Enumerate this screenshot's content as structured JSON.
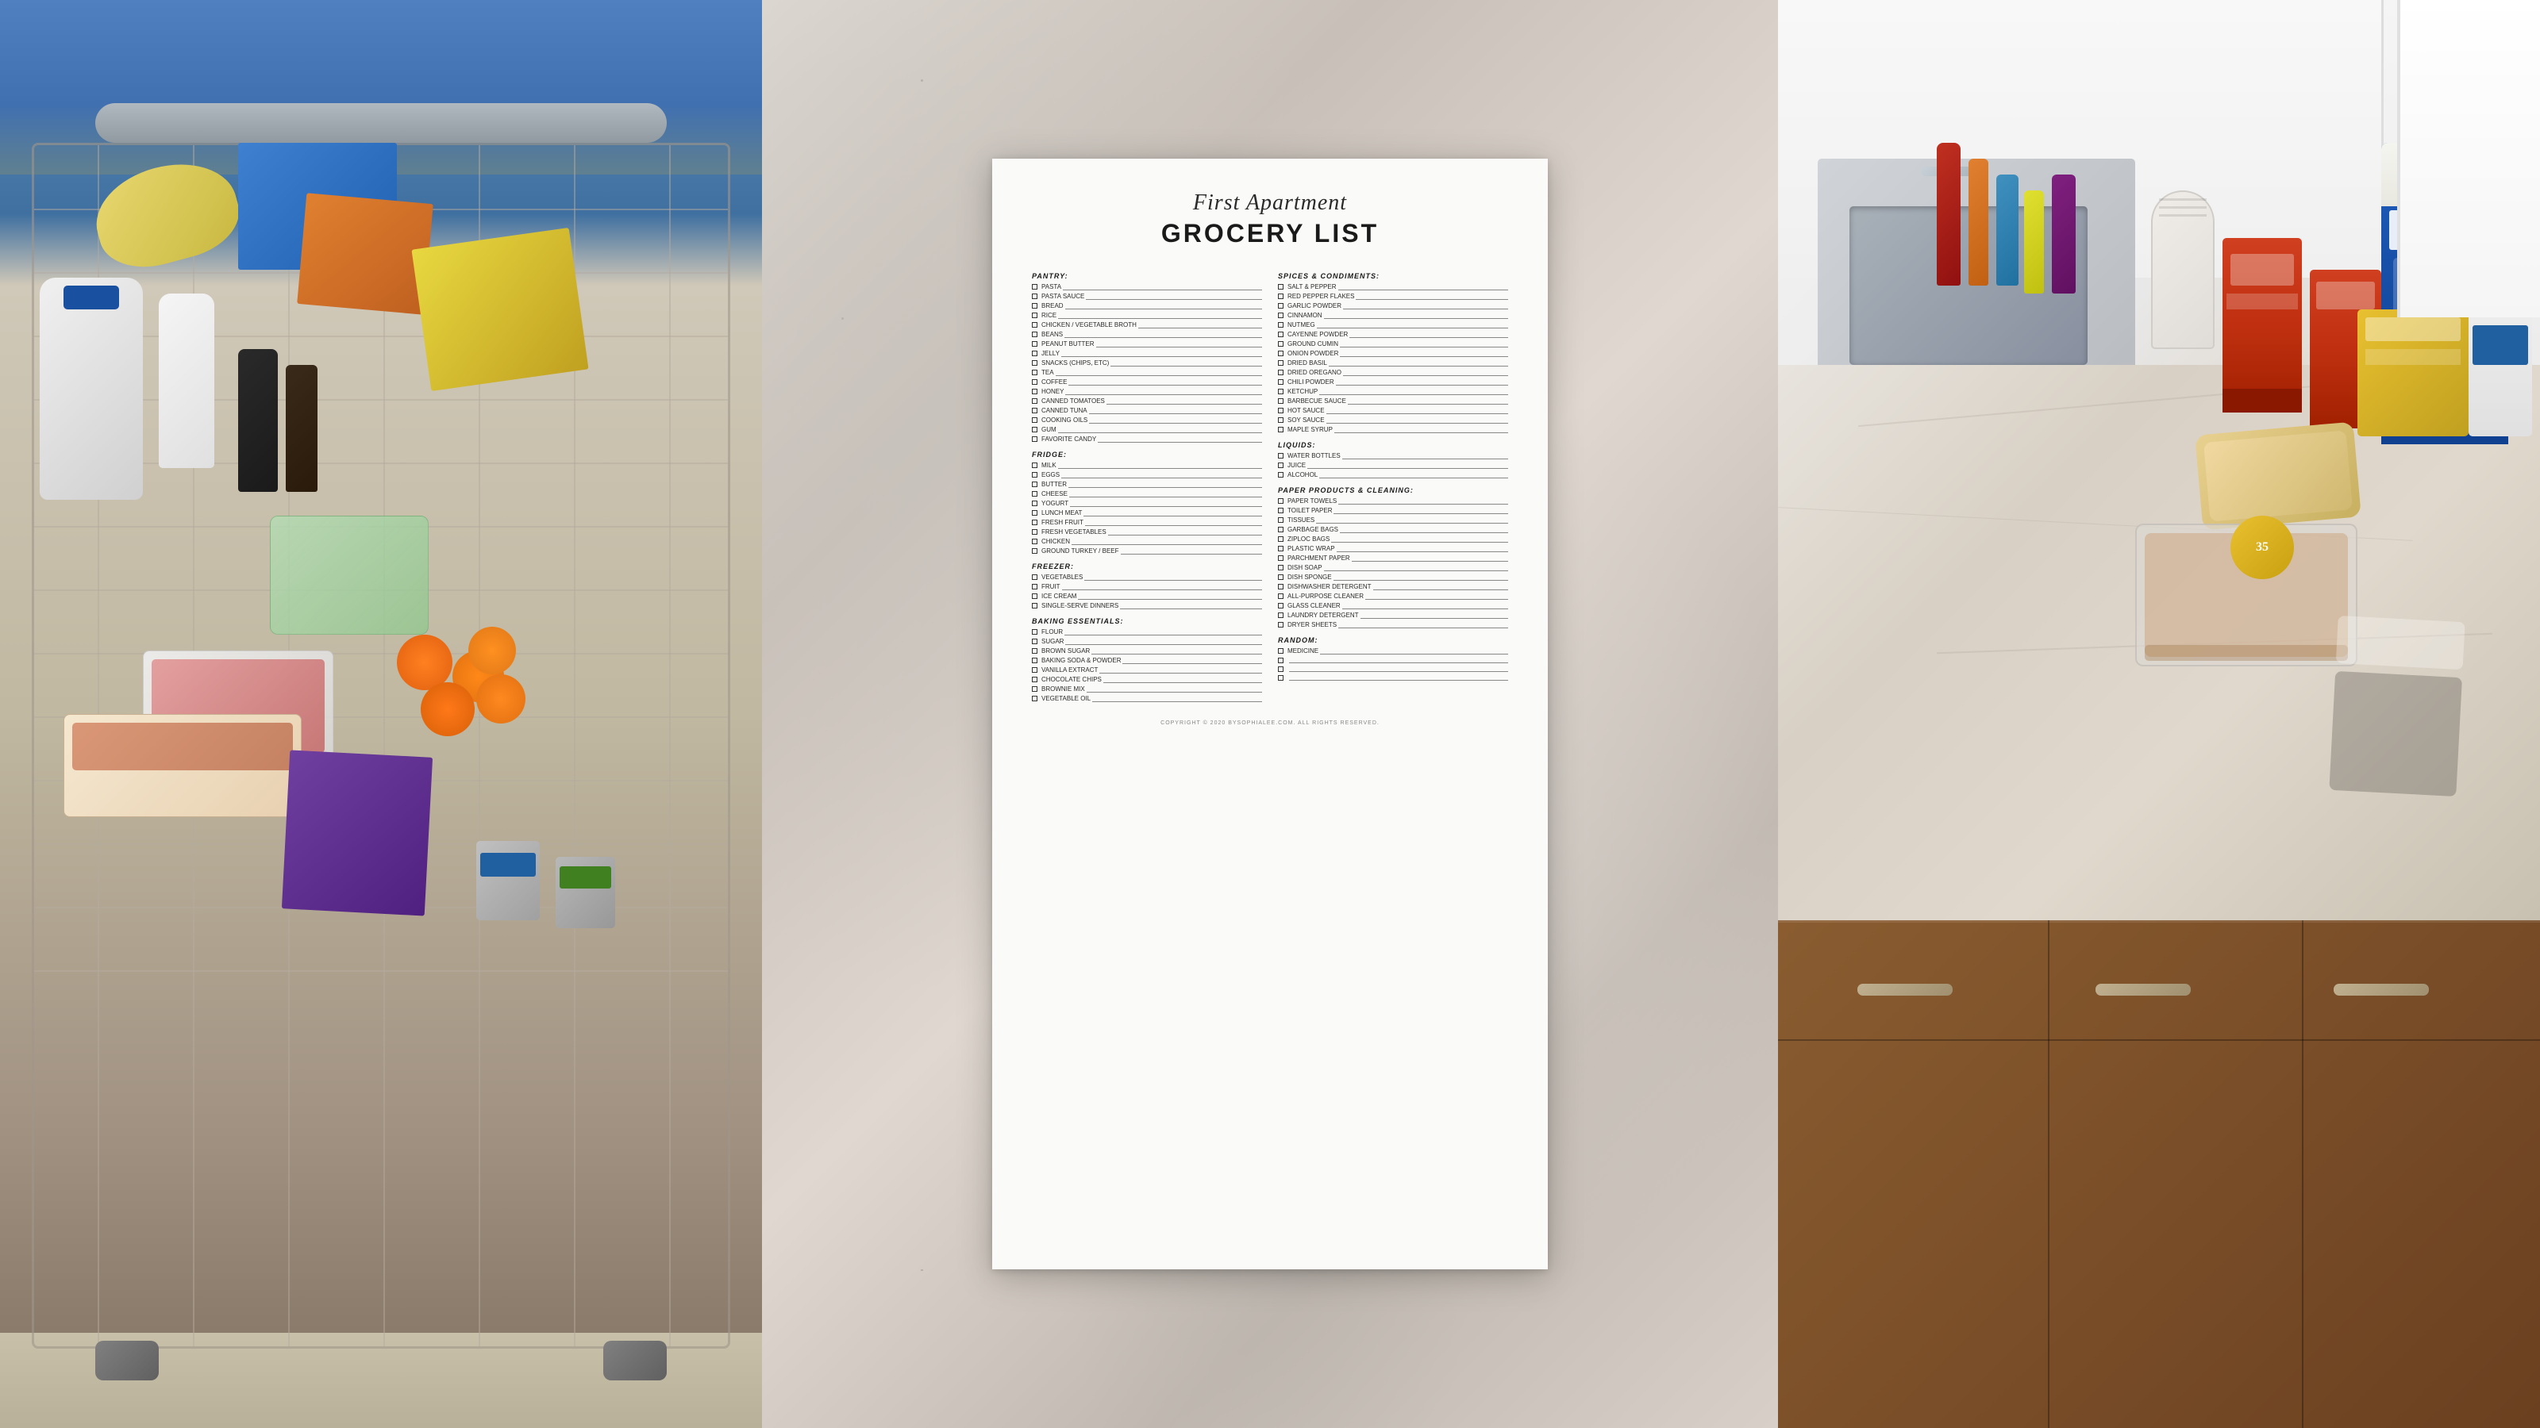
{
  "layout": {
    "panels": [
      "left",
      "center",
      "right"
    ]
  },
  "center_panel": {
    "title_script": "First Apartment",
    "title_main": "GROCERY LIST",
    "copyright": "COPYRIGHT © 2020 BYSOPHIALEE.COM. ALL RIGHTS RESERVED.",
    "sections": {
      "left_column": [
        {
          "title": "PANTRY:",
          "items": [
            "PASTA",
            "PASTA SAUCE",
            "BREAD",
            "RICE",
            "CHICKEN / VEGETABLE BROTH",
            "BEANS",
            "PEANUT BUTTER",
            "JELLY",
            "SNACKS (CHIPS, ETC)",
            "TEA",
            "COFFEE",
            "HONEY",
            "CANNED TOMATOES",
            "CANNED TUNA",
            "COOKING OILS",
            "GUM",
            "FAVORITE CANDY"
          ]
        },
        {
          "title": "FRIDGE:",
          "items": [
            "MILK",
            "EGGS",
            "BUTTER",
            "CHEESE",
            "YOGURT",
            "LUNCH MEAT",
            "FRESH FRUIT",
            "FRESH VEGETABLES",
            "CHICKEN",
            "GROUND TURKEY / BEEF"
          ]
        },
        {
          "title": "FREEZER:",
          "items": [
            "VEGETABLES",
            "FRUIT",
            "ICE CREAM",
            "SINGLE-SERVE DINNERS"
          ]
        },
        {
          "title": "BAKING ESSENTIALS:",
          "items": [
            "FLOUR",
            "SUGAR",
            "BROWN SUGAR",
            "BAKING SODA & POWDER",
            "VANILLA EXTRACT",
            "CHOCOLATE CHIPS",
            "BROWNIE MIX",
            "VEGETABLE OIL"
          ]
        }
      ],
      "right_column": [
        {
          "title": "SPICES & CONDIMENTS:",
          "items": [
            "SALT & PEPPER",
            "RED PEPPER FLAKES",
            "GARLIC POWDER",
            "CINNAMON",
            "NUTMEG",
            "CAYENNE POWDER",
            "GROUND CUMIN",
            "ONION POWDER",
            "DRIED BASIL",
            "DRIED OREGANO",
            "CHILI POWDER",
            "KETCHUP",
            "BARBECUE SAUCE",
            "HOT SAUCE",
            "SOY SAUCE",
            "MAPLE SYRUP"
          ]
        },
        {
          "title": "LIQUIDS:",
          "items": [
            "WATER BOTTLES",
            "JUICE",
            "ALCOHOL"
          ]
        },
        {
          "title": "PAPER PRODUCTS & CLEANING:",
          "items": [
            "PAPER TOWELS",
            "TOILET PAPER",
            "TISSUES",
            "GARBAGE BAGS",
            "ZIPLOC BAGS",
            "PLASTIC WRAP",
            "PARCHMENT PAPER",
            "DISH SOAP",
            "DISH SPONGE",
            "DISHWASHER DETERGENT",
            "ALL-PURPOSE CLEANER",
            "GLASS CLEANER",
            "LAUNDRY DETERGENT",
            "DRYER SHEETS"
          ]
        },
        {
          "title": "RANDOM:",
          "items": [
            "MEDICINE",
            "",
            "",
            ""
          ]
        }
      ]
    }
  },
  "left_panel": {
    "description": "Shopping cart filled with groceries",
    "colors": {
      "cart_metal": "#b0b8c0",
      "background_top": "#5080b0",
      "background_bottom": "#806040"
    }
  },
  "right_panel": {
    "description": "Kitchen counter with grocery items",
    "colors": {
      "counter": "#ddd8d0",
      "cabinet": "#804020"
    }
  }
}
